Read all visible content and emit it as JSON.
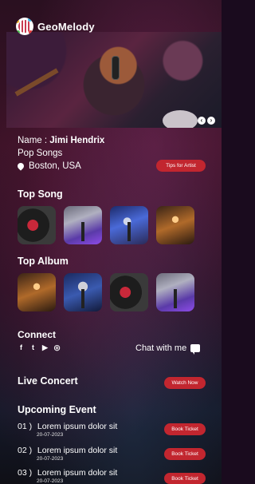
{
  "app": {
    "brand": "GeoMelody"
  },
  "hero": {
    "prev_icon": "chevron-left-icon",
    "next_icon": "chevron-right-icon"
  },
  "artist": {
    "name_label": "Name :",
    "name_value": "Jimi Hendrix",
    "genre": "Pop Songs",
    "location": "Boston, USA",
    "tips_button": "Tips for Artist"
  },
  "sections": {
    "top_song": "Top Song",
    "top_album": "Top Album",
    "connect": "Connect",
    "live_concert": "Live Concert",
    "upcoming_event": "Upcoming Event"
  },
  "socials": [
    "f",
    "t",
    "▶",
    "◎"
  ],
  "chat_label": "Chat with me",
  "watch_now": "Watch Now",
  "events": [
    {
      "num": "01 )",
      "title": "Lorem ipsum dolor sit",
      "date": "20-07-2023",
      "button": "Book Ticket"
    },
    {
      "num": "02 )",
      "title": "Lorem ipsum dolor sit",
      "date": "20-07-2023",
      "button": "Book Ticket"
    },
    {
      "num": "03 )",
      "title": "Lorem ipsum dolor sit",
      "date": "20-07-2023",
      "button": "Book Ticket"
    }
  ],
  "colors": {
    "accent": "#c2262f",
    "background": "#2a1020"
  }
}
